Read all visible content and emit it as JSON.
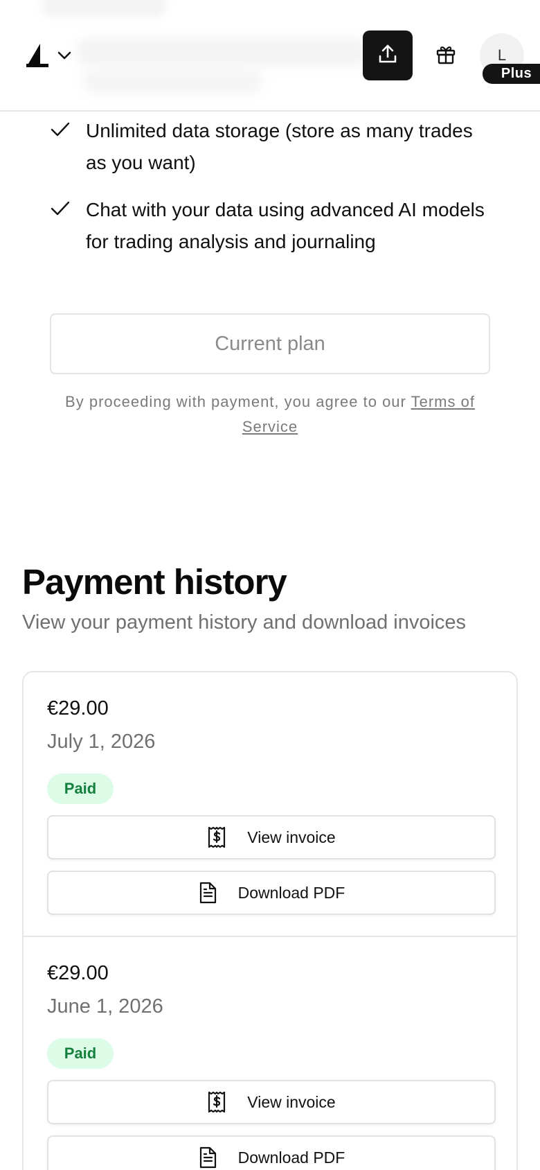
{
  "header": {
    "logo_icon": "app-logo-icon",
    "dropdown_icon": "chevron-down-icon",
    "share_icon": "upload-icon",
    "gift_icon": "gift-icon",
    "avatar_initial": "L",
    "plan_badge": "Plus"
  },
  "features": [
    {
      "text": "Unlimited data storage (store as many trades as you want)"
    },
    {
      "text": "Chat with your data using advanced AI models for trading analysis and journaling"
    }
  ],
  "plan": {
    "current_plan_label": "Current plan",
    "terms_prefix": "By proceeding with payment, you agree to our ",
    "terms_link": "Terms of Service"
  },
  "payment_history": {
    "title": "Payment history",
    "subtitle": "View your payment history and download invoices",
    "items": [
      {
        "amount": "€29.00",
        "date": "July 1, 2026",
        "status": "Paid",
        "view_label": "View invoice",
        "download_label": "Download PDF"
      },
      {
        "amount": "€29.00",
        "date": "June 1, 2026",
        "status": "Paid",
        "view_label": "View invoice",
        "download_label": "Download PDF"
      }
    ]
  },
  "colors": {
    "primary_dark": "#141414",
    "paid_bg": "#dcfce7",
    "paid_text": "#15803d",
    "muted_text": "#707070"
  }
}
